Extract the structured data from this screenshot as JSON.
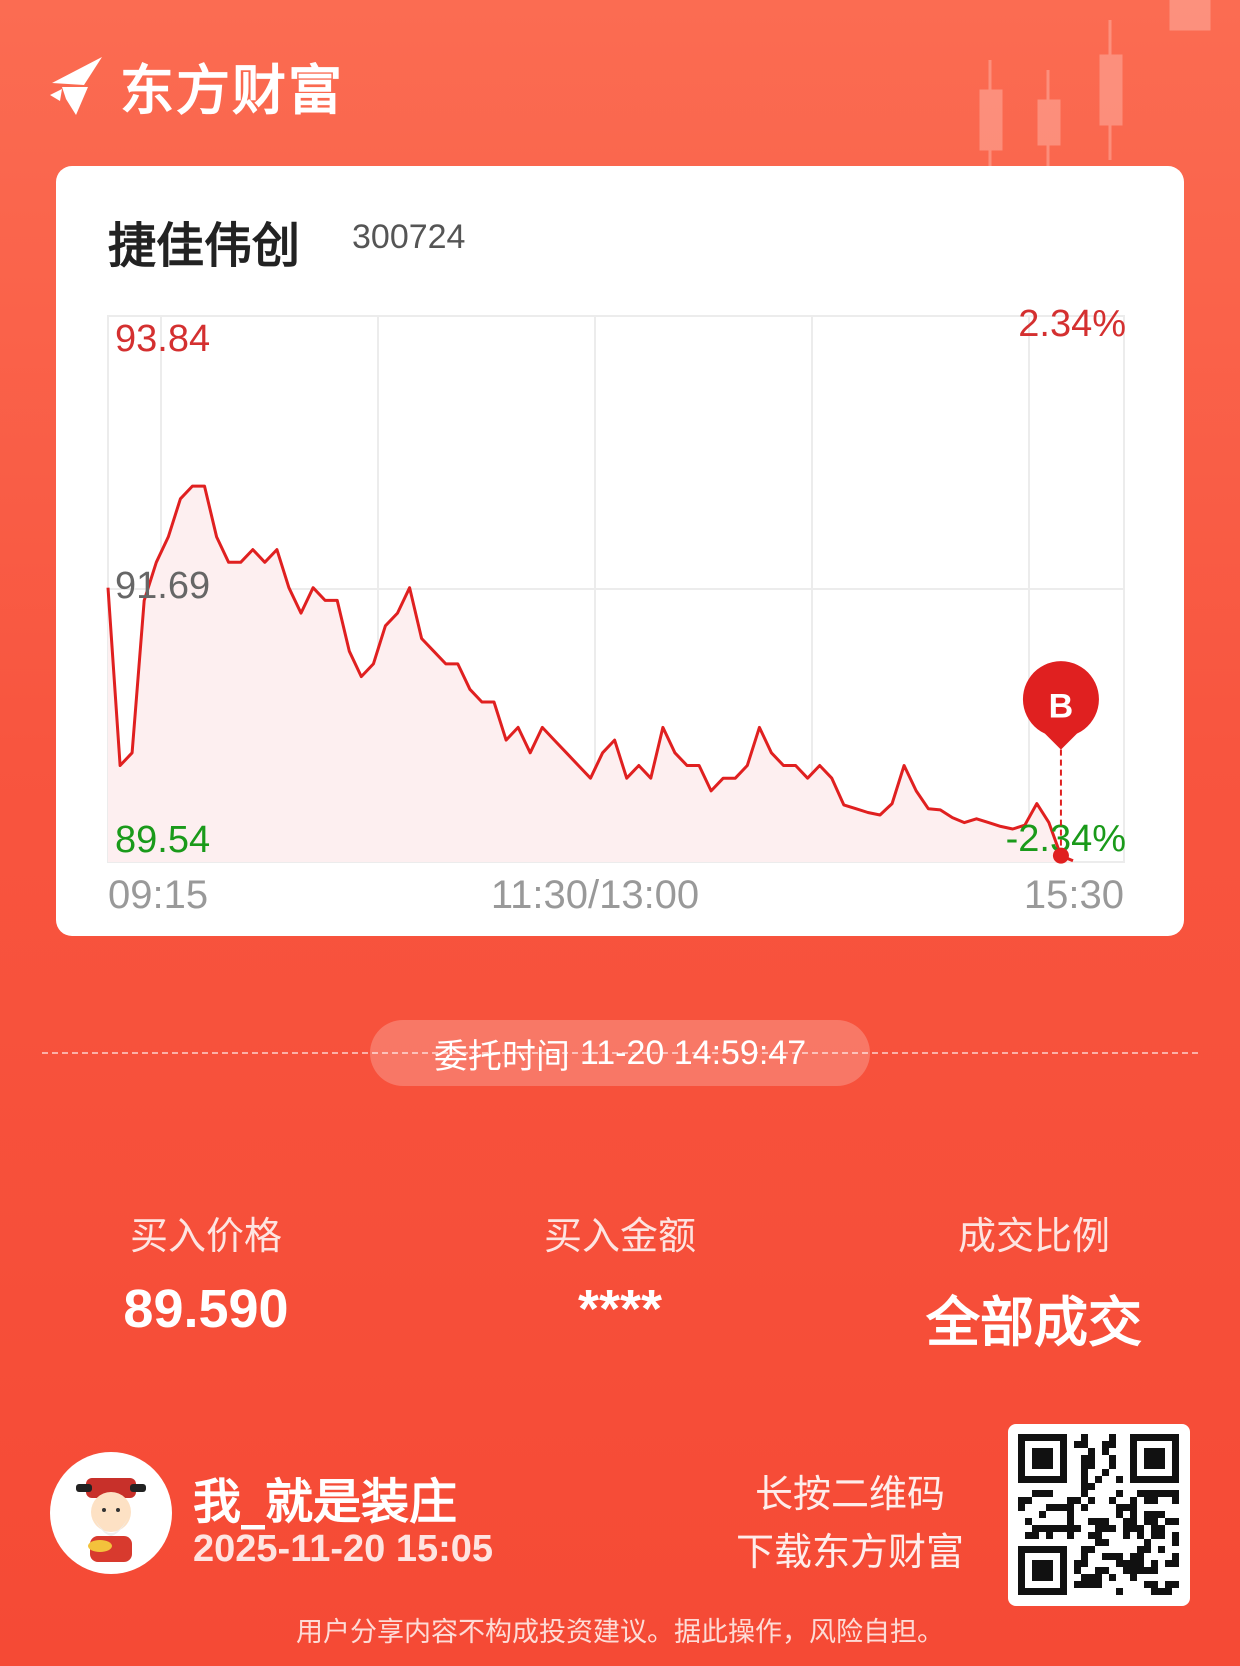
{
  "brand": {
    "name": "东方财富",
    "logo_icon": "eastmoney-logo-icon"
  },
  "stock": {
    "name": "捷佳伟创",
    "code": "300724"
  },
  "chart_data": {
    "type": "line",
    "title": "",
    "x_ticks": [
      "09:15",
      "11:30/13:00",
      "15:30"
    ],
    "y_left_labels": {
      "max": "93.84",
      "mid": "91.69",
      "min": "89.54"
    },
    "y_right_labels": {
      "max": "2.34%",
      "min": "-2.34%"
    },
    "ylim": [
      89.54,
      93.84
    ],
    "grid": true,
    "fill": true,
    "color": "#e02020",
    "marker": {
      "label": "B",
      "price": 89.59,
      "index": 79
    },
    "series": [
      {
        "values": [
          91.7,
          90.3,
          90.4,
          91.6,
          91.9,
          92.1,
          92.4,
          92.5,
          92.5,
          92.1,
          91.9,
          91.9,
          92.0,
          91.9,
          92.0,
          91.7,
          91.5,
          91.7,
          91.6,
          91.6,
          91.2,
          91.0,
          91.1,
          91.4,
          91.5,
          91.7,
          91.3,
          91.2,
          91.1,
          91.1,
          90.9,
          90.8,
          90.8,
          90.5,
          90.6,
          90.4,
          90.6,
          90.5,
          90.4,
          90.3,
          90.2,
          90.4,
          90.5,
          90.2,
          90.3,
          90.2,
          90.6,
          90.4,
          90.3,
          90.3,
          90.1,
          90.2,
          90.2,
          90.3,
          90.6,
          90.4,
          90.3,
          90.3,
          90.2,
          90.3,
          90.2,
          89.99,
          89.96,
          89.93,
          89.91,
          90.0,
          90.3,
          90.1,
          89.96,
          89.95,
          89.89,
          89.85,
          89.88,
          89.85,
          89.82,
          89.8,
          89.83,
          90.0,
          89.85,
          89.59,
          89.55
        ]
      }
    ]
  },
  "order": {
    "label": "委托时间",
    "time": "11-20 14:59:47"
  },
  "stats": [
    {
      "label": "买入价格",
      "value": "89.590"
    },
    {
      "label": "买入金额",
      "value": "****"
    },
    {
      "label": "成交比例",
      "value": "全部成交"
    }
  ],
  "user": {
    "name": "我_就是装庄",
    "time": "2025-11-20 15:05",
    "avatar_icon": "god-of-wealth-avatar-icon"
  },
  "qr": {
    "hint_line1": "长按二维码",
    "hint_line2": "下载东方财富",
    "icon": "qr-code-icon"
  },
  "disclaimer": "用户分享内容不构成投资建议。据此操作，风险自担。"
}
